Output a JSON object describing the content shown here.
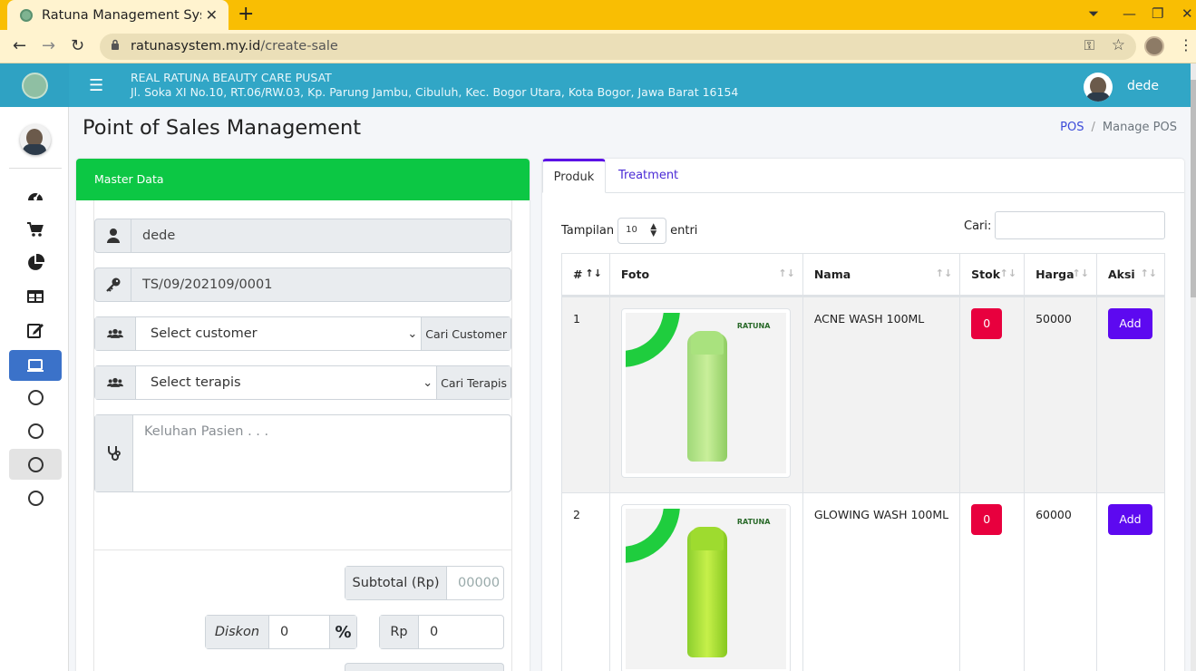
{
  "browser": {
    "tab_title": "Ratuna Management Syst",
    "url_host": "ratunasystem.my.id",
    "url_path": "/create-sale"
  },
  "header": {
    "store_name": "REAL RATUNA BEAUTY CARE PUSAT",
    "store_address": "Jl. Soka XI No.10, RT.06/RW.03, Kp. Parung Jambu, Cibuluh, Kec. Bogor Utara, Kota Bogor, Jawa Barat 16154",
    "user": "dede"
  },
  "page": {
    "title": "Point of Sales Management",
    "breadcrumb_link": "POS",
    "breadcrumb_current": "Manage POS"
  },
  "master": {
    "header": "Master Data",
    "user": "dede",
    "transaction_code": "TS/09/202109/0001",
    "customer_select": "Select customer",
    "customer_button": "Cari Customer",
    "terapis_select": "Select terapis",
    "terapis_button": "Cari Terapis",
    "keluhan_placeholder": "Keluhan Pasien . . .",
    "subtotal_label": "Subtotal (Rp)",
    "subtotal_value": "00000",
    "diskon_label": "Diskon",
    "diskon_value": "0",
    "percent": "%",
    "rp_label": "Rp",
    "rp_value": "0"
  },
  "products": {
    "tab_produk": "Produk",
    "tab_treatment": "Treatment",
    "tampilan_label": "Tampilan",
    "tampilan_value": "10",
    "entri_label": "entri",
    "cari_label": "Cari:",
    "columns": [
      "#",
      "Foto",
      "Nama",
      "Stok",
      "Harga",
      "Aksi"
    ],
    "rows": [
      {
        "no": "1",
        "nama": "ACNE WASH 100ML",
        "stok": "0",
        "harga": "50000",
        "aksi": "Add"
      },
      {
        "no": "2",
        "nama": "GLOWING WASH 100ML",
        "stok": "0",
        "harga": "60000",
        "aksi": "Add"
      }
    ],
    "photo_logo_text": "RATUNA"
  },
  "colors": {
    "header_bg": "#31a6c6",
    "master_header": "#0cc744",
    "add_button": "#5d09f0",
    "stock_badge": "#e8003e",
    "browser_tabbar": "#f9be03"
  }
}
